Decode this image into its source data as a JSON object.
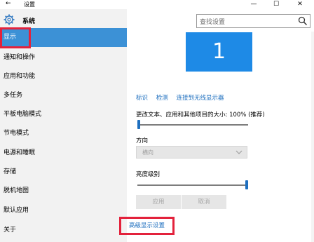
{
  "window": {
    "title": "设置",
    "back_glyph": "←",
    "minimize_glyph": "—",
    "maximize_glyph": "☐",
    "close_glyph": "✕"
  },
  "sidebar": {
    "header_icon": "gear-icon",
    "header_label": "系统",
    "items": [
      {
        "label": "显示",
        "active": true
      },
      {
        "label": "通知和操作"
      },
      {
        "label": "应用和功能"
      },
      {
        "label": "多任务"
      },
      {
        "label": "平板电脑模式"
      },
      {
        "label": "节电模式"
      },
      {
        "label": "电源和睡眠"
      },
      {
        "label": "存储"
      },
      {
        "label": "脱机地图"
      },
      {
        "label": "默认应用"
      },
      {
        "label": "关于"
      }
    ]
  },
  "search": {
    "placeholder": "查找设置",
    "icon": "search-icon"
  },
  "display": {
    "monitor_number": "1",
    "links": [
      "标识",
      "检测",
      "连接到无线显示器"
    ],
    "scale_label": "更改文本、应用和其他项目的大小: 100% (推荐)",
    "scale_level": 0,
    "orientation_label": "方向",
    "orientation_value": "横向",
    "brightness_label": "亮度级别",
    "brightness_level": 1.0,
    "apply_label": "应用",
    "cancel_label": "取消",
    "advanced_link": "高级显示设置"
  },
  "colors": {
    "accent": "#1e8ae6",
    "active_item": "#3c91d6",
    "highlight_box": "#e3223c",
    "link": "#1e6fbf"
  }
}
